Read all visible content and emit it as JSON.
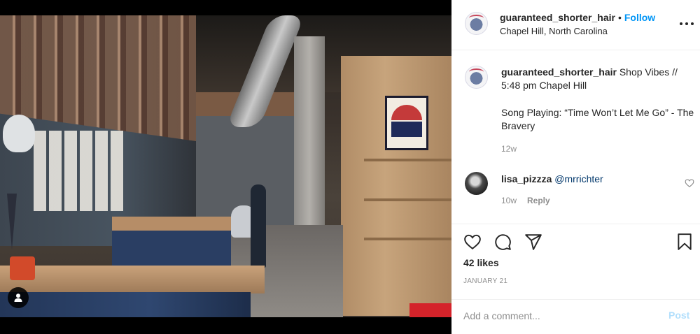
{
  "post": {
    "username": "guaranteed_shorter_hair",
    "dot": "•",
    "follow_label": "Follow",
    "location": "Chapel Hill, North Carolina"
  },
  "caption": {
    "username": "guaranteed_shorter_hair",
    "text": "Shop Vibes // 5:48 pm Chapel Hill",
    "song": "Song Playing: “Time Won’t Let Me Go” - The Bravery",
    "time": "12w"
  },
  "comment": {
    "username": "lisa_pizzza",
    "mention": "@mrrichter",
    "time": "10w",
    "reply_label": "Reply"
  },
  "engagement": {
    "likes": "42 likes",
    "date": "JANUARY 21"
  },
  "add_comment": {
    "placeholder": "Add a comment...",
    "post_label": "Post"
  },
  "colors": {
    "link_blue": "#0095f6",
    "post_disabled": "#b2dffc",
    "muted_text": "#8e8e8e",
    "text": "#262626"
  },
  "icons": [
    "user-tag-icon",
    "more-options-icon",
    "small-heart-icon",
    "like-icon",
    "comment-icon",
    "share-icon",
    "save-icon"
  ]
}
